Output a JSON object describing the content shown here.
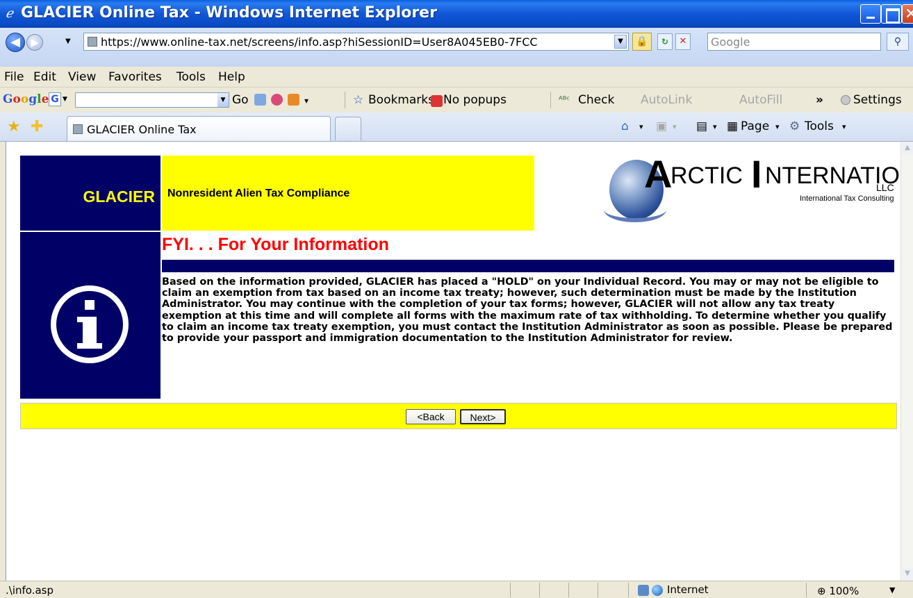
{
  "window": {
    "title": "GLACIER Online Tax - Windows Internet Explorer",
    "controls": [
      "minimize",
      "maximize",
      "close"
    ]
  },
  "address_bar": {
    "url": "https://www.online-tax.net/screens/info.asp?hiSessionID=User8A045EB0-7FCC",
    "search_placeholder": "Google"
  },
  "menu": {
    "items": [
      "File",
      "Edit",
      "View",
      "Favorites",
      "Tools",
      "Help"
    ]
  },
  "google_toolbar": {
    "logo": "Google",
    "go_label": "Go",
    "bookmarks_label": "Bookmarks",
    "popups_label": "No popups",
    "check_label": "Check",
    "autolink_label": "AutoLink",
    "autofill_label": "AutoFill",
    "more_label": "»",
    "settings_label": "Settings"
  },
  "tabs": {
    "active_tab": "GLACIER Online Tax",
    "page_menu": "Page",
    "tools_menu": "Tools"
  },
  "page": {
    "brand": "GLACIER",
    "subtitle": "Nonresident Alien Tax Compliance",
    "logo_company": "ARCTIC INTERNATIONAL LLC",
    "logo_tagline": "International Tax Consulting",
    "heading": "FYI. . . For Your Information",
    "message": "Based on the information provided, GLACIER has placed a \"HOLD\" on your Individual Record. You may or may not be eligible to claim an exemption from tax based on an income tax treaty; however, such determination must be made by the Institution Administrator. You may continue with the completion of your tax forms; however, GLACIER will not allow any tax treaty exemption at this time and will complete all forms with the maximum rate of tax withholding. To determine whether you qualify to claim an income tax treaty exemption, you must contact the Institution Administrator as soon as possible. Please be prepared to provide your passport and immigration documentation to the Institution Administrator for review.",
    "back_button": "<Back",
    "next_button": "Next>"
  },
  "status_bar": {
    "status_text": ".\\info.asp",
    "zone": "Internet",
    "zoom": "100%"
  },
  "colors": {
    "navy": "#000066",
    "yellow": "#FFFF00",
    "heading_red": "#FF0000"
  }
}
